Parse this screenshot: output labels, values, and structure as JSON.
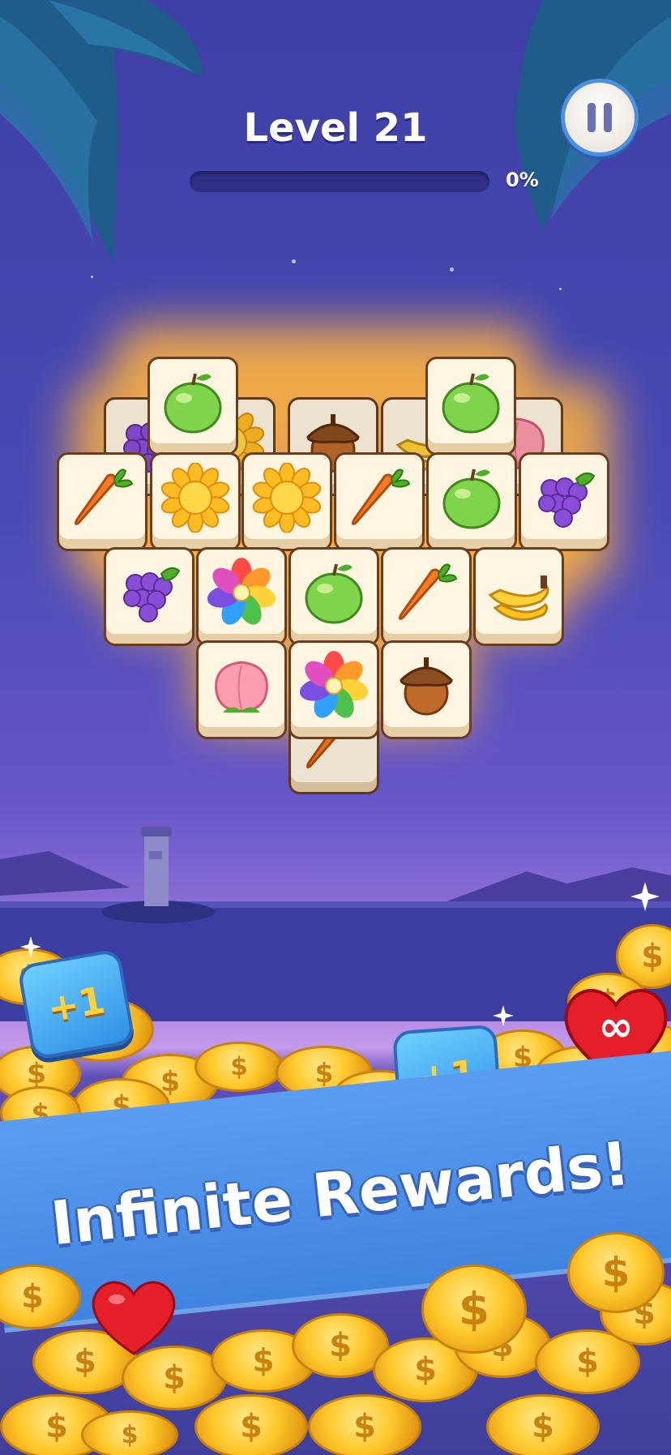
{
  "hud": {
    "level_label": "Level 21",
    "progress_text": "0%",
    "progress_fraction": 0
  },
  "tiles": {
    "fruit_colors": {
      "apple": "#7fd44b",
      "sun": "#ffd23a",
      "carrot": "#f47b24",
      "grapes": "#8a4ed6",
      "flower": "rainbow",
      "banana": "#ffd23a",
      "peach": "#ff9db0",
      "acorn": "#9c5a26"
    },
    "board": [
      {
        "layer": "back",
        "icon": "grapes-icon"
      },
      {
        "layer": "back",
        "icon": "sun-icon"
      },
      {
        "layer": "back",
        "icon": "acorn-icon"
      },
      {
        "layer": "back",
        "icon": "banana-icon"
      },
      {
        "layer": "back",
        "icon": "peach-icon"
      },
      {
        "layer": "top",
        "icon": "apple-icon"
      },
      {
        "layer": "top",
        "icon": "apple-icon"
      },
      {
        "layer": "row1",
        "icon": "carrot-icon"
      },
      {
        "layer": "row1",
        "icon": "sun-icon"
      },
      {
        "layer": "row1",
        "icon": "sun-icon"
      },
      {
        "layer": "row1",
        "icon": "carrot-icon"
      },
      {
        "layer": "row1",
        "icon": "apple-icon"
      },
      {
        "layer": "row1",
        "icon": "grapes-icon"
      },
      {
        "layer": "row2",
        "icon": "grapes-icon"
      },
      {
        "layer": "row2",
        "icon": "flower-icon"
      },
      {
        "layer": "row2",
        "icon": "apple-icon"
      },
      {
        "layer": "row2",
        "icon": "carrot-icon"
      },
      {
        "layer": "row2",
        "icon": "banana-icon"
      },
      {
        "layer": "row3",
        "icon": "peach-icon"
      },
      {
        "layer": "row3",
        "icon": "flower-icon"
      },
      {
        "layer": "row3",
        "icon": "acorn-icon"
      },
      {
        "layer": "bottom",
        "icon": "carrot-icon"
      }
    ]
  },
  "promo": {
    "plus_one": "+1",
    "coin_symbol": "$",
    "infinite_symbol": "∞",
    "headline": "Infinite Rewards!"
  },
  "colors": {
    "sky_top": "#3e3fa6",
    "tile_face": "#fff6e2",
    "tile_border": "#6b3d1c",
    "glow": "#ffb23e",
    "banner": "#4a8ee8",
    "coin": "#ffc92c"
  }
}
